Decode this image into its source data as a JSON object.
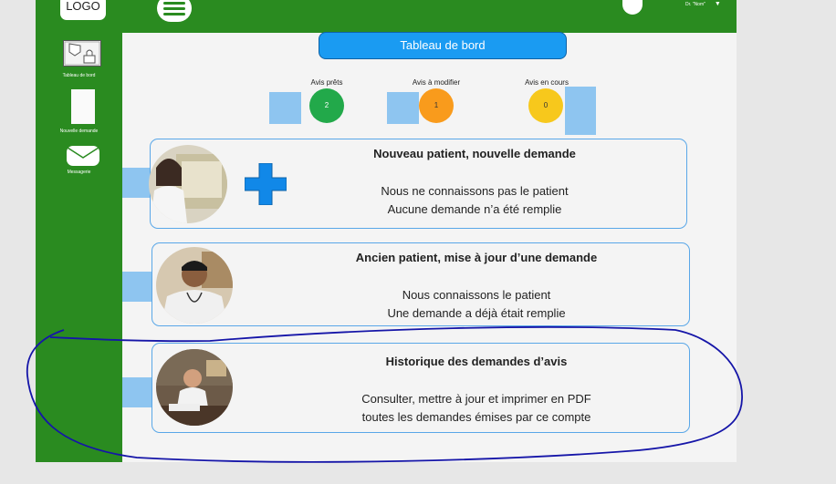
{
  "header": {
    "logo": "LOGO",
    "user_name": "Dr. \"Nom\"",
    "user_caret": "▼"
  },
  "sidebar": {
    "items": [
      {
        "label": "Tableau de bord",
        "icon": "dashboard-icon"
      },
      {
        "label": "Nouvelle demande",
        "icon": "document-icon"
      },
      {
        "label": "Messagerie",
        "icon": "mail-icon"
      }
    ]
  },
  "main": {
    "title": "Tableau de bord",
    "stats": [
      {
        "label": "Avis prêts",
        "value": "2",
        "color": "#22a94a"
      },
      {
        "label": "Avis à modifier",
        "value": "1",
        "color": "#f99b1c"
      },
      {
        "label": "Avis en cours",
        "value": "0",
        "color": "#f7c81c"
      }
    ],
    "cards": [
      {
        "title": "Nouveau patient, nouvelle demande",
        "line1": "Nous ne connaissons pas le patient",
        "line2": "Aucune demande n’a été remplie"
      },
      {
        "title": "Ancien patient, mise à jour d’une demande",
        "line1": "Nous connaissons le patient",
        "line2": "Une demande a déjà était remplie"
      },
      {
        "title": "Historique des demandes d’avis",
        "line1": "Consulter, mettre à jour et imprimer en PDF",
        "line2": "toutes les demandes émises par ce compte"
      }
    ]
  },
  "colors": {
    "brand_green": "#2a8b20",
    "accent_blue": "#1a9bf2",
    "plus_blue": "#1188e8",
    "note_blue": "#8ec5f0",
    "scribble": "#1515a8"
  }
}
